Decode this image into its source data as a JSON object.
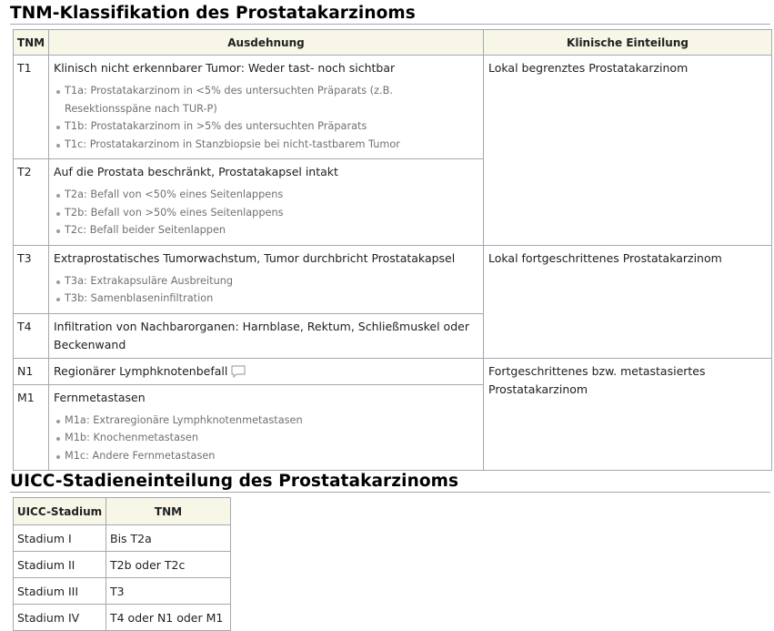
{
  "heading1": "TNM-Klassifikation des Prostatakarzinoms",
  "tnm_table": {
    "headers": [
      "TNM",
      "Ausdehnung",
      "Klinische Einteilung"
    ],
    "rows": [
      {
        "code": "T1",
        "description": "Klinisch nicht erkennbarer Tumor: Weder tast- noch sichtbar",
        "subitems": [
          "T1a: Prostatakarzinom in <5% des untersuchten Präparats (z.B. Resektionsspäne nach TUR-P)",
          "T1b: Prostatakarzinom in >5% des untersuchten Präparats",
          "T1c: Prostatakarzinom in Stanzbiopsie bei nicht-tastbarem Tumor"
        ]
      },
      {
        "code": "T2",
        "description": "Auf die Prostata beschränkt, Prostatakapsel intakt",
        "subitems": [
          "T2a: Befall von <50% eines Seitenlappens",
          "T2b: Befall von >50% eines Seitenlappens",
          "T2c: Befall beider Seitenlappen"
        ]
      },
      {
        "code": "T3",
        "description": "Extraprostatisches Tumorwachstum, Tumor durchbricht Prostatakapsel",
        "subitems": [
          "T3a: Extrakapsuläre Ausbreitung",
          "T3b: Samenblaseninfiltration"
        ]
      },
      {
        "code": "T4",
        "description": "Infiltration von Nachbarorganen: Harnblase, Rektum, Schließmuskel oder Beckenwand",
        "subitems": []
      },
      {
        "code": "N1",
        "description": "Regionärer Lymphknotenbefall",
        "subitems": []
      },
      {
        "code": "M1",
        "description": "Fernmetastasen",
        "subitems": [
          "M1a: Extraregionäre Lymphknotenmetastasen",
          "M1b: Knochenmetastasen",
          "M1c: Andere Fernmetastasen"
        ]
      }
    ],
    "clinical": [
      "Lokal begrenztes Prostatakarzinom",
      "Lokal fortgeschrittenes Prostatakarzinom",
      "Fortgeschrittenes bzw. metastasiertes Prostatakarzinom"
    ]
  },
  "heading2": "UICC-Stadieneinteilung des Prostatakarzinoms",
  "uicc_table": {
    "headers": [
      "UICC-Stadium",
      "TNM"
    ],
    "rows": [
      [
        "Stadium I",
        "Bis T2a"
      ],
      [
        "Stadium II",
        "T2b oder T2c"
      ],
      [
        "Stadium III",
        "T3"
      ],
      [
        "Stadium IV",
        "T4 oder N1 oder M1"
      ]
    ]
  },
  "icons": {
    "comment": "comment-icon"
  }
}
